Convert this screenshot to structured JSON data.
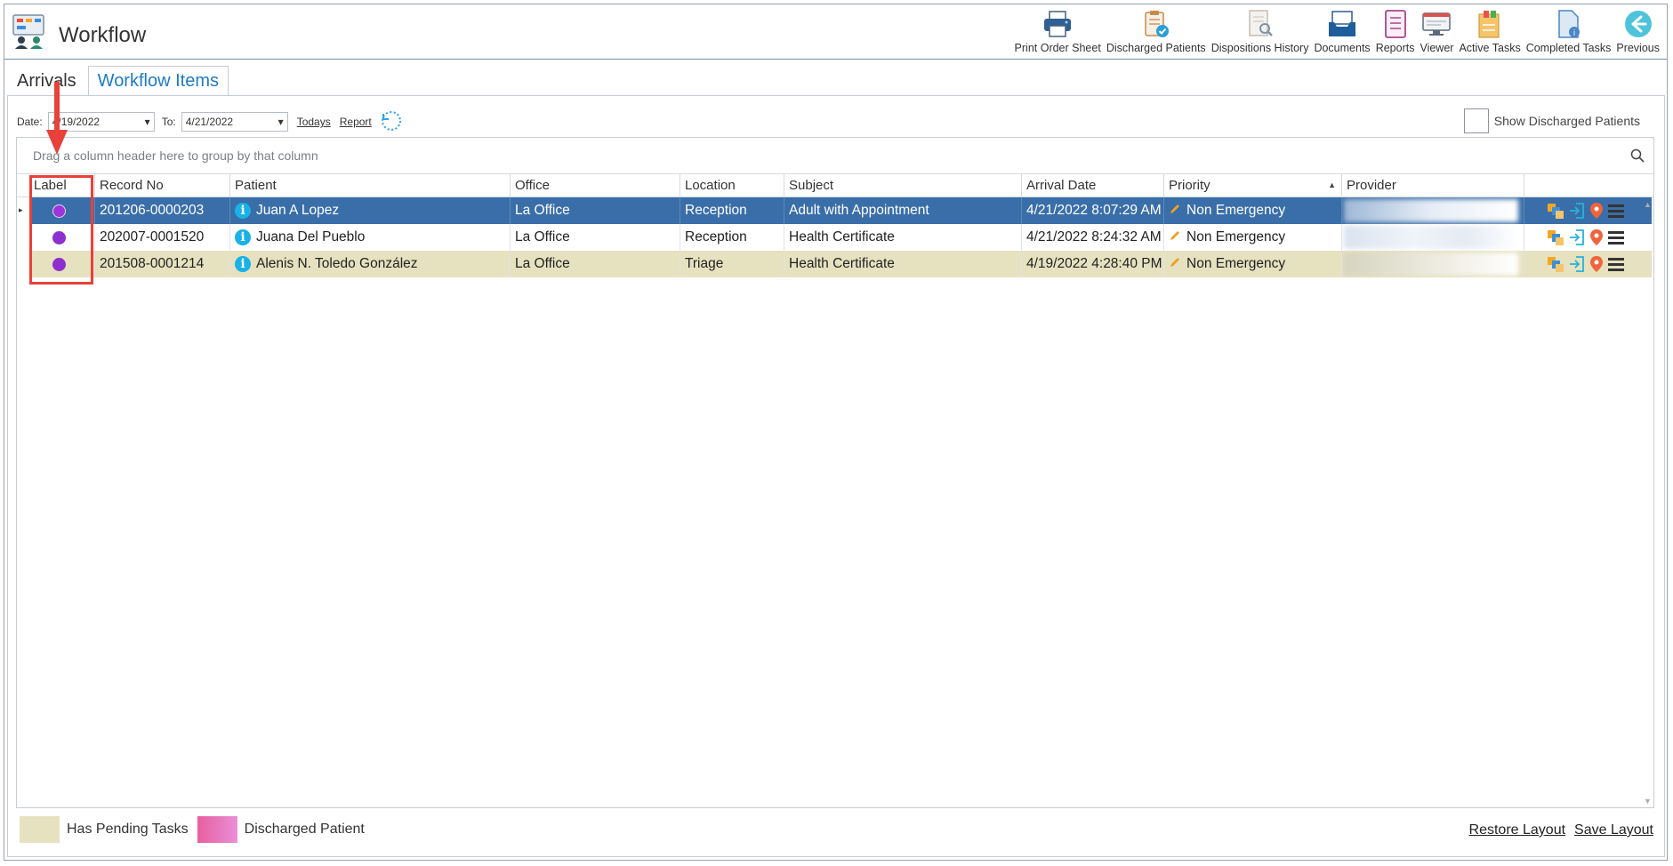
{
  "app": {
    "title": "Workflow"
  },
  "toolbar": {
    "items": [
      {
        "label": "Print Order Sheet",
        "icon": "printer-icon"
      },
      {
        "label": "Discharged Patients",
        "icon": "clipboard-check-icon"
      },
      {
        "label": "Dispositions History",
        "icon": "document-search-icon"
      },
      {
        "label": "Documents",
        "icon": "inbox-tray-icon"
      },
      {
        "label": "Reports",
        "icon": "report-icon"
      },
      {
        "label": "Viewer",
        "icon": "monitor-icon"
      },
      {
        "label": "Active Tasks",
        "icon": "tasks-icon"
      },
      {
        "label": "Completed Tasks",
        "icon": "completed-tasks-icon"
      },
      {
        "label": "Previous",
        "icon": "arrow-left-circle-icon"
      }
    ]
  },
  "tabs": [
    {
      "label": "Arrivals",
      "active": false
    },
    {
      "label": "Workflow Items",
      "active": true
    }
  ],
  "filter": {
    "date_label": "Date:",
    "date_from": "4/19/2022",
    "to_label": "To:",
    "date_to": "4/21/2022",
    "todays_label": "Todays",
    "report_label": "Report",
    "show_discharged_label": "Show Discharged Patients"
  },
  "grid": {
    "group_hint": "Drag a column header here to group by that column",
    "columns": [
      "Label",
      "Record No",
      "Patient",
      "Office",
      "Location",
      "Subject",
      "Arrival Date",
      "Priority",
      "Provider"
    ],
    "rows": [
      {
        "record_no": "201206-0000203",
        "patient": "Juan A Lopez",
        "office": "La Office",
        "location": "Reception",
        "subject": "Adult with Appointment",
        "arrival_date": "4/21/2022 8:07:29 AM",
        "priority": "Non Emergency",
        "state": "selected"
      },
      {
        "record_no": "202007-0001520",
        "patient": "Juana Del Pueblo",
        "office": "La Office",
        "location": "Reception",
        "subject": "Health Certificate",
        "arrival_date": "4/21/2022 8:24:32 AM",
        "priority": "Non Emergency",
        "state": "normal"
      },
      {
        "record_no": "201508-0001214",
        "patient": "Alenis N. Toledo González",
        "office": "La Office",
        "location": "Triage",
        "subject": "Health Certificate",
        "arrival_date": "4/19/2022 4:28:40 PM",
        "priority": "Non Emergency",
        "state": "pending"
      }
    ]
  },
  "legend": {
    "pending_label": "Has Pending Tasks",
    "pending_color": "#e6e1bf",
    "discharged_label": "Discharged Patient",
    "discharged_color": "#e66fb5"
  },
  "footer": {
    "restore_label": "Restore Layout",
    "save_label": "Save Layout"
  },
  "colors": {
    "selected_row": "#3a6ea8",
    "label_dot": "#8e2fcf",
    "accent": "#1e7bc4",
    "annotation": "#e8413a"
  }
}
